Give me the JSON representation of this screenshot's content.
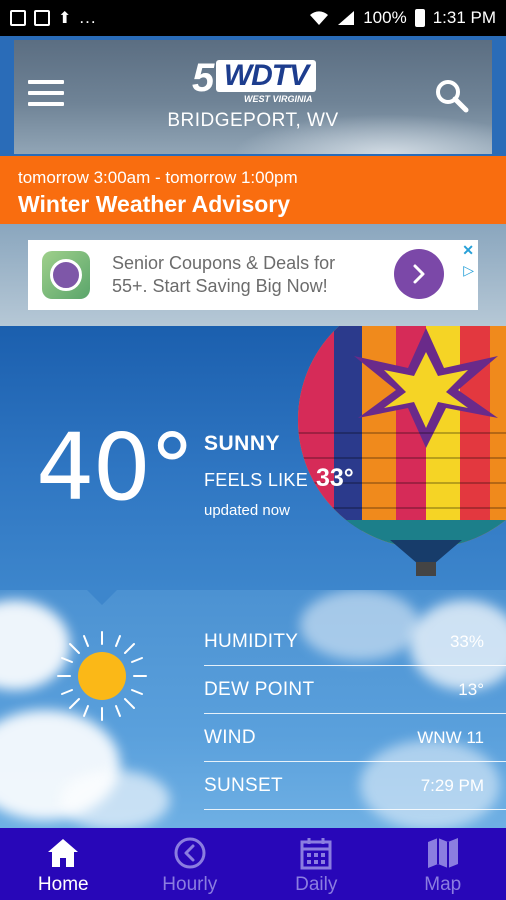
{
  "status_bar": {
    "battery": "100%",
    "time": "1:31 PM",
    "dots": "..."
  },
  "header": {
    "logo_number": "5",
    "logo_text": "WDTV",
    "logo_subtext": "WEST VIRGINIA",
    "location": "BRIDGEPORT, WV"
  },
  "advisory": {
    "time_range": "tomorrow 3:00am - tomorrow 1:00pm",
    "title": "Winter Weather Advisory"
  },
  "ad": {
    "text": "Senior Coupons & Deals for 55+. Start Saving Big Now!"
  },
  "current": {
    "temperature": "40°",
    "condition": "SUNNY",
    "feels_like_label": "FEELS LIKE",
    "feels_like_value": "33°",
    "updated": "updated now"
  },
  "details": [
    {
      "label": "HUMIDITY",
      "value": "33%"
    },
    {
      "label": "DEW POINT",
      "value": "13°"
    },
    {
      "label": "WIND",
      "value": "WNW 11"
    },
    {
      "label": "SUNSET",
      "value": "7:29 PM"
    }
  ],
  "nav": [
    {
      "label": "Home",
      "icon": "home-icon",
      "active": true
    },
    {
      "label": "Hourly",
      "icon": "clock-icon",
      "active": false
    },
    {
      "label": "Daily",
      "icon": "calendar-icon",
      "active": false
    },
    {
      "label": "Map",
      "icon": "map-icon",
      "active": false
    }
  ],
  "colors": {
    "advisory": "#f96d0f",
    "nav_bg": "#2807b8",
    "ad_button": "#7b48a8"
  }
}
